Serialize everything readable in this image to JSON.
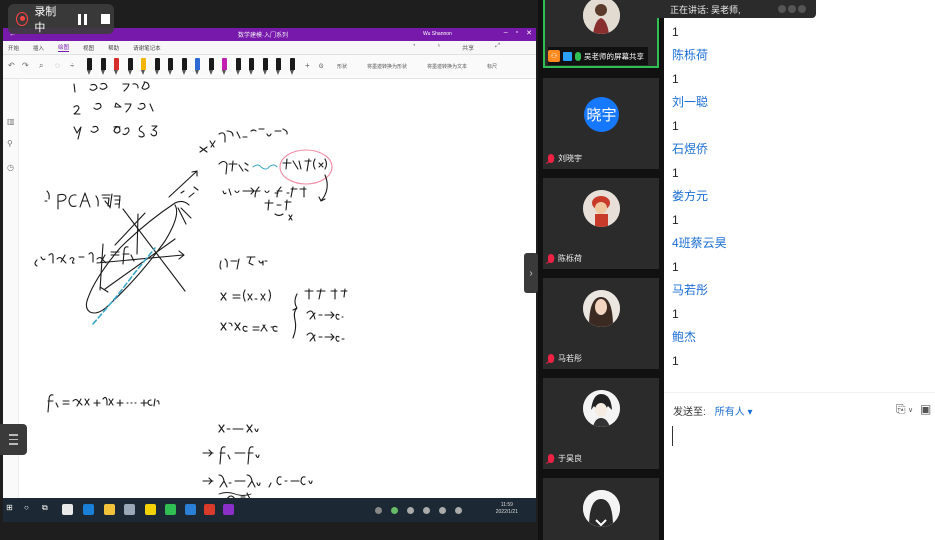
{
  "recording": {
    "label": "录制中"
  },
  "onenote": {
    "window_title": "数学建模·入门系列",
    "user": "Wu Shannon",
    "menu": [
      "开始",
      "插入",
      "绘图",
      "视图",
      "帮助",
      "请谢笔记本"
    ],
    "active_menu_index": 2,
    "menu_right": [
      "共享"
    ],
    "toolbar_labels": [
      "形状",
      "将墨迹转换为形状",
      "将墨迹转换为文本",
      "标尺"
    ],
    "pen_colors": [
      "#1a1a1a",
      "#1a1a1a",
      "#d62c2c",
      "#1a1a1a",
      "#f2b600",
      "#1a1a1a",
      "#1a1a1a",
      "#1a1a1a",
      "#2c6bd6",
      "#1a1a1a",
      "#c21fb0",
      "#1a1a1a",
      "#1a1a1a",
      "#1a1a1a",
      "#1a1a1a",
      "#1a1a1a"
    ],
    "clock": {
      "time": "11:59",
      "date": "2022/1/21"
    }
  },
  "participants": [
    {
      "name": "吴老师的屏幕共享",
      "kind": "screen-share",
      "active": true
    },
    {
      "name": "刘晓宇",
      "avatar_text": "晓宇",
      "kind": "initials"
    },
    {
      "name": "陈栎荷",
      "kind": "photo-doll"
    },
    {
      "name": "马若彤",
      "kind": "photo-girl"
    },
    {
      "name": "于昊良",
      "kind": "photo-anime"
    }
  ],
  "chat": {
    "toast": "正在讲话: 吴老师,",
    "messages": [
      {
        "text": "1"
      },
      {
        "sender": "陈栎荷",
        "text": "1"
      },
      {
        "sender": "刘一聪",
        "text": "1"
      },
      {
        "sender": "石煜侨",
        "text": "1"
      },
      {
        "sender": "娄方元",
        "text": "1"
      },
      {
        "sender": "4班蔡云昊",
        "text": "1"
      },
      {
        "sender": "马若彤",
        "text": "1"
      },
      {
        "sender": "鲍杰",
        "text": "1"
      }
    ],
    "send_to_label": "发送至:",
    "send_to_value": "所有人 ▾"
  }
}
